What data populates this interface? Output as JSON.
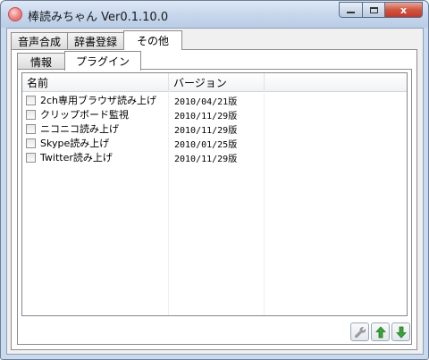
{
  "window": {
    "title": "棒読みちゃん Ver0.1.10.0",
    "close_label": "x",
    "minimize_label": "_",
    "maximize_label": "□"
  },
  "tabs_top": [
    {
      "label": "音声合成"
    },
    {
      "label": "辞書登録"
    },
    {
      "label": "その他"
    }
  ],
  "tabs_inner": [
    {
      "label": "情報"
    },
    {
      "label": "プラグイン"
    }
  ],
  "plugin_list": {
    "columns": [
      "名前",
      "バージョン",
      ""
    ],
    "rows": [
      {
        "name": "2ch専用ブラウザ読み上げ",
        "version": "2010/04/21版",
        "checked": false
      },
      {
        "name": "クリップボード監視",
        "version": "2010/11/29版",
        "checked": false
      },
      {
        "name": "ニコニコ読み上げ",
        "version": "2010/11/29版",
        "checked": false
      },
      {
        "name": "Skype読み上げ",
        "version": "2010/01/25版",
        "checked": false
      },
      {
        "name": "Twitter読み上げ",
        "version": "2010/11/29版",
        "checked": false
      }
    ]
  },
  "buttons": {
    "settings_icon": "wrench-icon",
    "up_icon": "arrow-up-icon",
    "down_icon": "arrow-down-icon"
  },
  "colors": {
    "close_red": "#c0392b",
    "arrow_green": "#3aa33a",
    "titlebar": "#c7d7ec"
  }
}
